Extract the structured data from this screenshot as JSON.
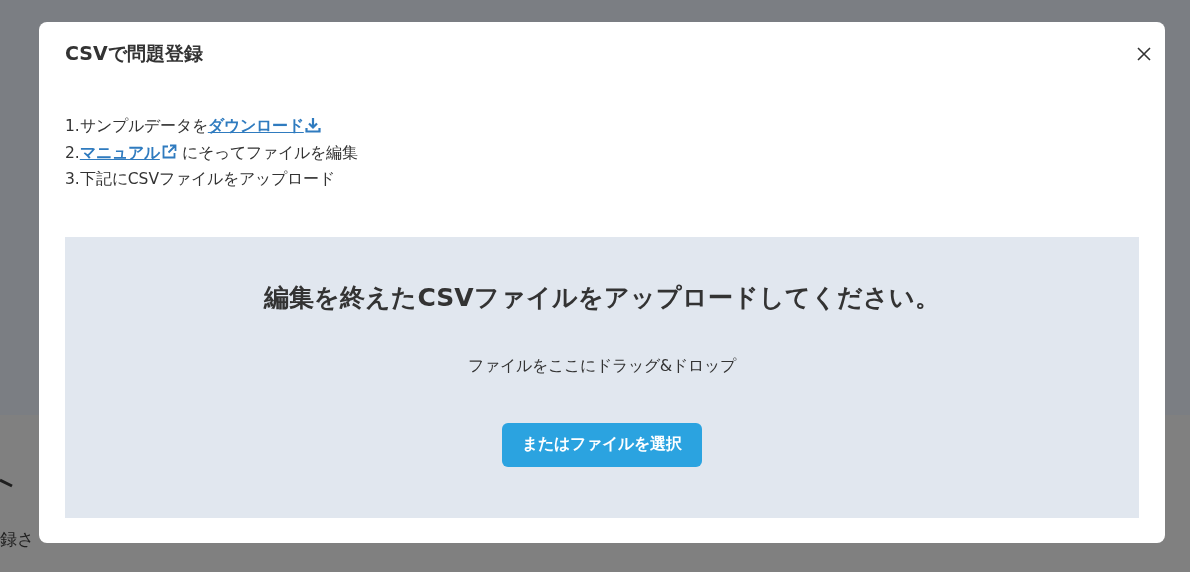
{
  "background": {
    "notice_text": "録さ"
  },
  "dialog": {
    "title": "CSVで問題登録",
    "steps": [
      {
        "parts": [
          {
            "kind": "text",
            "text": "1.サンプルデータを"
          },
          {
            "kind": "download_link",
            "text": "ダウンロード"
          }
        ]
      },
      {
        "parts": [
          {
            "kind": "text",
            "text": "2."
          },
          {
            "kind": "external_link",
            "text": "マニュアル"
          },
          {
            "kind": "text",
            "text": " にそってファイルを編集"
          }
        ]
      },
      {
        "parts": [
          {
            "kind": "text",
            "text": "3.下記にCSVファイルをアップロード"
          }
        ]
      }
    ],
    "dropzone": {
      "heading": "編集を終えたCSVファイルをアップロードしてください。",
      "hint": "ファイルをここにドラッグ&ドロップ",
      "button": "またはファイルを選択"
    }
  }
}
